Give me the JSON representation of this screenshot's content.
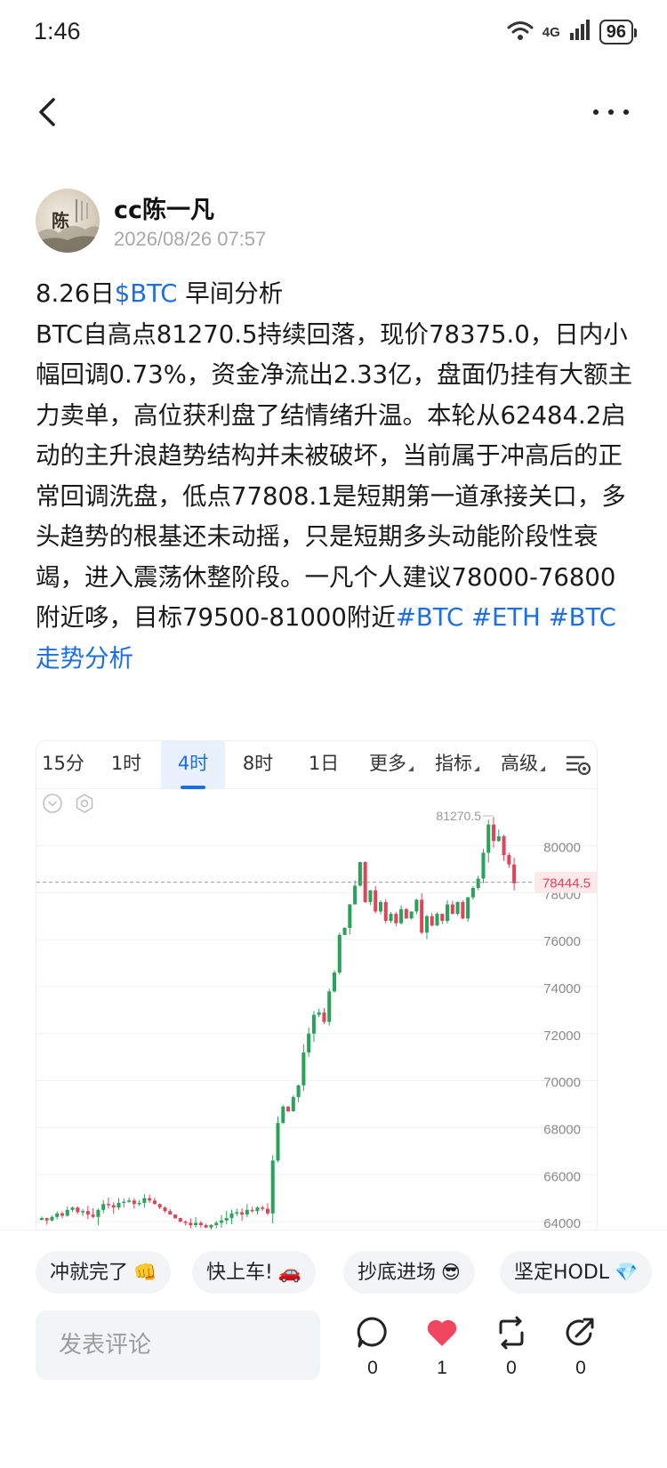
{
  "status_bar": {
    "time": "1:46",
    "network": "4G",
    "battery": "96"
  },
  "nav": {
    "back_icon": "chevron-left-icon",
    "more_icon": "more-horizontal-icon"
  },
  "author": {
    "name": "cc陈一凡",
    "avatar_text": "陈",
    "post_time": "2026/08/26 07:57"
  },
  "post": {
    "title_prefix": "8.26日",
    "title_link": "$BTC",
    "title_suffix": " 早间分析",
    "body": "BTC自高点81270.5持续回落，现价78375.0，日内小幅回调0.73%，资金净流出2.33亿，盘面仍挂有大额主力卖单，高位获利盘了结情绪升温。本轮从62484.2启动的主升浪趋势结构并未被破坏，当前属于冲高后的正常回调洗盘，低点77808.1是短期第一道承接关口，多头趋势的根基还未动摇，只是短期多头动能阶段性衰竭，进入震荡休整阶段。一凡个人建议78000-76800附近哆，目标79500-81000附近",
    "tags": [
      "#BTC",
      "#ETH",
      "#BTC走势分析"
    ]
  },
  "chart": {
    "tabs": [
      "15分",
      "1时",
      "4时",
      "8时",
      "1日",
      "更多",
      "指标",
      "高级"
    ],
    "active_tab": "4时",
    "accent": "#1c6fe0",
    "up_color": "#2aa35a",
    "down_color": "#e0445a"
  },
  "chart_data": {
    "type": "candlestick",
    "y_ticks": [
      80000,
      78000,
      76000,
      74000,
      72000,
      70000,
      68000,
      66000,
      64000
    ],
    "ylim": [
      63700,
      81800
    ],
    "high_label": "81270.5",
    "current_price": "78444.5",
    "series_close": [
      64150,
      64050,
      64200,
      64350,
      64250,
      64500,
      64600,
      64400,
      64450,
      64300,
      64200,
      64500,
      64750,
      64700,
      64600,
      64800,
      64850,
      64900,
      64750,
      64800,
      65000,
      64900,
      64750,
      64600,
      64450,
      64300,
      64150,
      64000,
      63950,
      63850,
      63950,
      63850,
      63750,
      63850,
      63950,
      64050,
      64150,
      64350,
      64400,
      64300,
      64500,
      64450,
      64600,
      64550,
      64350,
      66600,
      68200,
      68900,
      68700,
      69300,
      69800,
      71200,
      72000,
      72800,
      72900,
      72500,
      73800,
      74600,
      76200,
      76500,
      77500,
      78300,
      79300,
      77600,
      78100,
      77200,
      77600,
      76800,
      77100,
      76700,
      77300,
      76900,
      77200,
      77700,
      76300,
      77000,
      76600,
      77100,
      76800,
      77500,
      77100,
      77600,
      76900,
      77800,
      78200,
      78600,
      79700,
      80900,
      80200,
      80400,
      79600,
      79200,
      78400
    ]
  },
  "quick_replies": [
    {
      "label": "冲就完了",
      "emoji": "👊"
    },
    {
      "label": "快上车!",
      "emoji": "🚗"
    },
    {
      "label": "抄底进场",
      "emoji": "😎"
    },
    {
      "label": "坚定HODL",
      "emoji": "💎"
    }
  ],
  "comment": {
    "placeholder": "发表评论"
  },
  "actions": {
    "comments": {
      "icon": "comment-icon",
      "count": "0"
    },
    "likes": {
      "icon": "heart-icon",
      "count": "1"
    },
    "reposts": {
      "icon": "repost-icon",
      "count": "0"
    },
    "shares": {
      "icon": "share-icon",
      "count": "0"
    }
  }
}
